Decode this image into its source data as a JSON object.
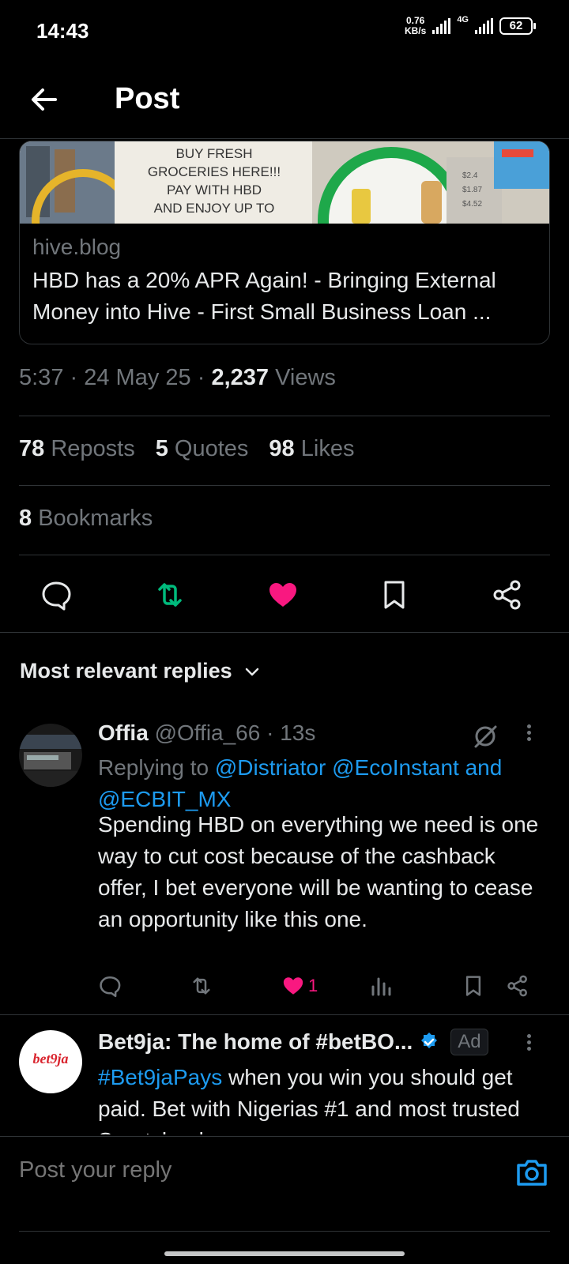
{
  "status_bar": {
    "time": "14:43",
    "net_speed_value": "0.76",
    "net_speed_unit": "KB/s",
    "network_type": "4G",
    "battery": "62"
  },
  "header": {
    "title": "Post"
  },
  "link_card": {
    "image_lines": [
      "BUY FRESH",
      "GROCERIES HERE!!!",
      "PAY WITH HBD",
      "AND ENJOY UP TO"
    ],
    "domain": "hive.blog",
    "title": "HBD has a 20% APR Again! - Bringing External Money into Hive - First Small Business Loan ..."
  },
  "post_meta": {
    "time": "5:37",
    "date": "24 May 25",
    "views_count": "2,237",
    "views_label": "Views"
  },
  "stats": {
    "reposts_count": "78",
    "reposts_label": "Reposts",
    "quotes_count": "5",
    "quotes_label": "Quotes",
    "likes_count": "98",
    "likes_label": "Likes",
    "bookmarks_count": "8",
    "bookmarks_label": "Bookmarks"
  },
  "actions": [
    "reply-icon",
    "repost-icon",
    "heart-icon",
    "bookmark-icon",
    "share-icon"
  ],
  "colors": {
    "background": "#000000",
    "text": "#e7e9ea",
    "muted": "#71767b",
    "link": "#1d9bf0",
    "repost": "#00ba7c",
    "like": "#f91880"
  },
  "replies_sort": {
    "label": "Most relevant replies"
  },
  "reply": {
    "name": "Offia",
    "handle": "@Offia_66",
    "time": "13s",
    "replying_prefix": "Replying to",
    "replying_to": "@Distriator @EcoInstant and @ECBIT_MX",
    "text": "Spending HBD on everything we need is one way to cut cost because of the cashback offer, I bet everyone will be wanting to cease an opportunity like this one.",
    "likes": "1"
  },
  "ad": {
    "avatar_text": "bet9ja",
    "name": "Bet9ja: The home of #betBO...",
    "badge": "Ad",
    "hashtag": "#Bet9jaPays",
    "text": " when you win you should get paid. Bet with Nigerias #1 and most trusted Sportsbook"
  },
  "composer": {
    "placeholder": "Post your reply"
  }
}
